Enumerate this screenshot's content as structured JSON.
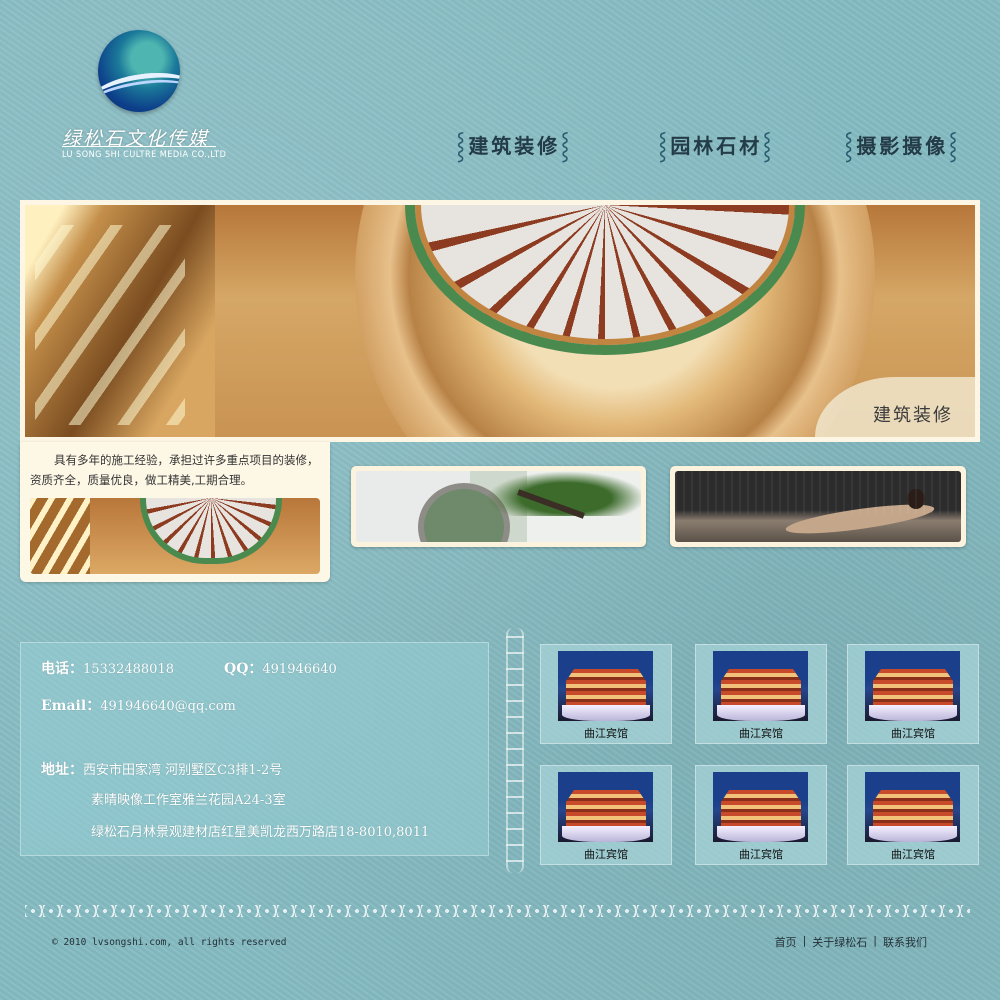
{
  "logo": {
    "cn": "绿松石文化传媒",
    "en": "LU SONG SHI CULTRE MEDIA CO.,LTD"
  },
  "nav": [
    {
      "label": "建筑装修"
    },
    {
      "label": "园林石材"
    },
    {
      "label": "摄影摄像"
    }
  ],
  "banner": {
    "label": "建筑装修"
  },
  "intro": {
    "text": "具有多年的施工经验，承担过许多重点项目的装修，资质齐全，质量优良，做工精美,工期合理。"
  },
  "contact": {
    "phone_label": "电话：",
    "phone": "15332488018",
    "qq_label": "QQ：",
    "qq": "491946640",
    "email_label": "Email：",
    "email": "491946640@qq.com",
    "address_label": "地址：",
    "address_1": "西安市田家湾 河别墅区C3排1-2号",
    "address_2": "素晴映像工作室雅兰花园A24-3室",
    "address_3": "绿松石月林景观建材店红星美凯龙西万路店18-8010,8011"
  },
  "hotels": [
    {
      "caption": "曲江宾馆"
    },
    {
      "caption": "曲江宾馆"
    },
    {
      "caption": "曲江宾馆"
    },
    {
      "caption": "曲江宾馆"
    },
    {
      "caption": "曲江宾馆"
    },
    {
      "caption": "曲江宾馆"
    }
  ],
  "footer": {
    "copyright": "© 2010 lvsongshi.com, all rights reserved",
    "links": [
      "首页",
      "关于绿松石",
      "联系我们"
    ],
    "separator": "|"
  },
  "colors": {
    "background": "#86bcc3",
    "panel": "#fdf6e4",
    "nav_text": "#243c48"
  }
}
